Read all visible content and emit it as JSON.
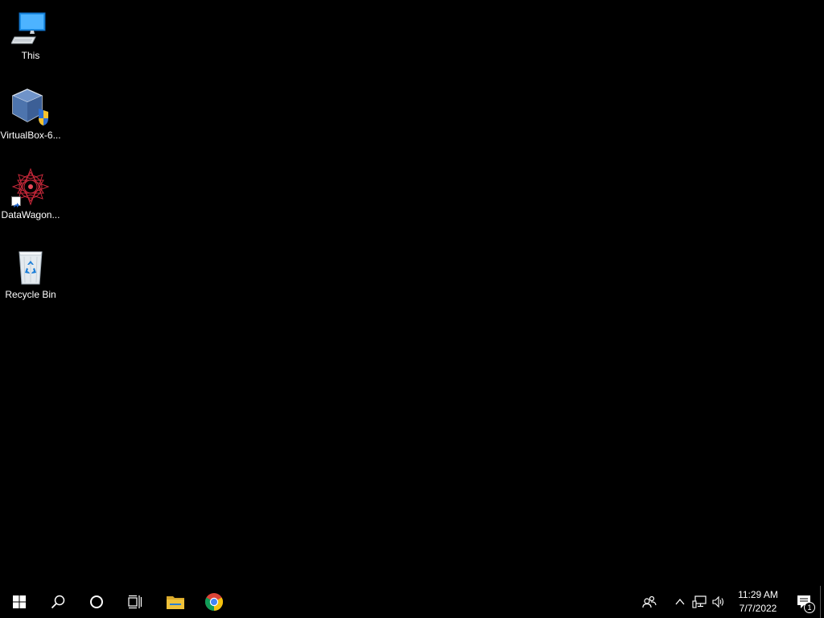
{
  "desktop": {
    "icons": [
      {
        "label": "This",
        "icon": "computer-icon"
      },
      {
        "label": "VirtualBox-6...",
        "icon": "virtualbox-installer-icon"
      },
      {
        "label": "DataWagon...",
        "icon": "datawagon-shortcut-icon"
      },
      {
        "label": "Recycle Bin",
        "icon": "recycle-bin-icon"
      }
    ]
  },
  "taskbar": {
    "buttons": [
      {
        "name": "start",
        "icon": "windows-logo-icon"
      },
      {
        "name": "search",
        "icon": "search-icon"
      },
      {
        "name": "cortana",
        "icon": "cortana-circle-icon"
      },
      {
        "name": "task-view",
        "icon": "task-view-icon"
      },
      {
        "name": "file-explorer",
        "icon": "folder-icon"
      },
      {
        "name": "chrome",
        "icon": "chrome-icon"
      }
    ],
    "tray": {
      "icons": [
        "people-icon",
        "chevron-up-icon",
        "network-icon",
        "volume-icon"
      ],
      "time": "11:29 AM",
      "date": "7/7/2022",
      "notifications_count": "1"
    }
  },
  "colors": {
    "desktop_bg": "#000000",
    "taskbar_bg": "#000000",
    "folder_yellow": "#f0c23a",
    "chrome_red": "#db4437",
    "chrome_yellow": "#f4c20d",
    "chrome_green": "#0f9d58",
    "chrome_blue": "#4285f4"
  }
}
